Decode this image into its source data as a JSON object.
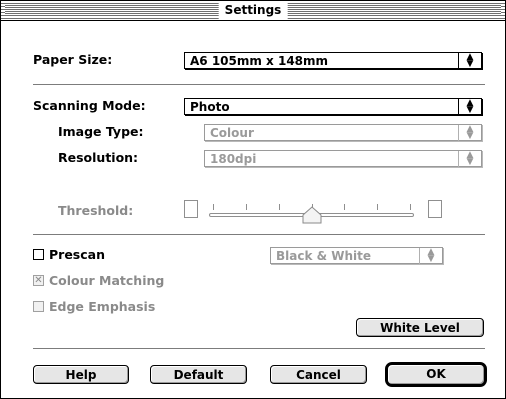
{
  "window": {
    "title": "Settings"
  },
  "paper": {
    "label": "Paper Size:",
    "value": "A6 105mm x 148mm"
  },
  "scanning": {
    "label": "Scanning Mode:",
    "value": "Photo"
  },
  "image_type": {
    "label": "Image Type:",
    "value": "Colour"
  },
  "resolution": {
    "label": "Resolution:",
    "value": "180dpi"
  },
  "threshold": {
    "label": "Threshold:",
    "slider_fraction": 0.5,
    "ticks": 7
  },
  "prescan": {
    "label": "Prescan",
    "checked": false
  },
  "prescan_mode": {
    "value": "Black & White"
  },
  "colour_matching": {
    "label": "Colour Matching",
    "checked": true
  },
  "edge_emphasis": {
    "label": "Edge Emphasis",
    "checked": false
  },
  "buttons": {
    "white_level": "White Level",
    "help": "Help",
    "default": "Default",
    "cancel": "Cancel",
    "ok": "OK"
  },
  "icons": {
    "popup_arrows": "up-down-arrows-icon",
    "check_mark": "x-mark-icon"
  }
}
